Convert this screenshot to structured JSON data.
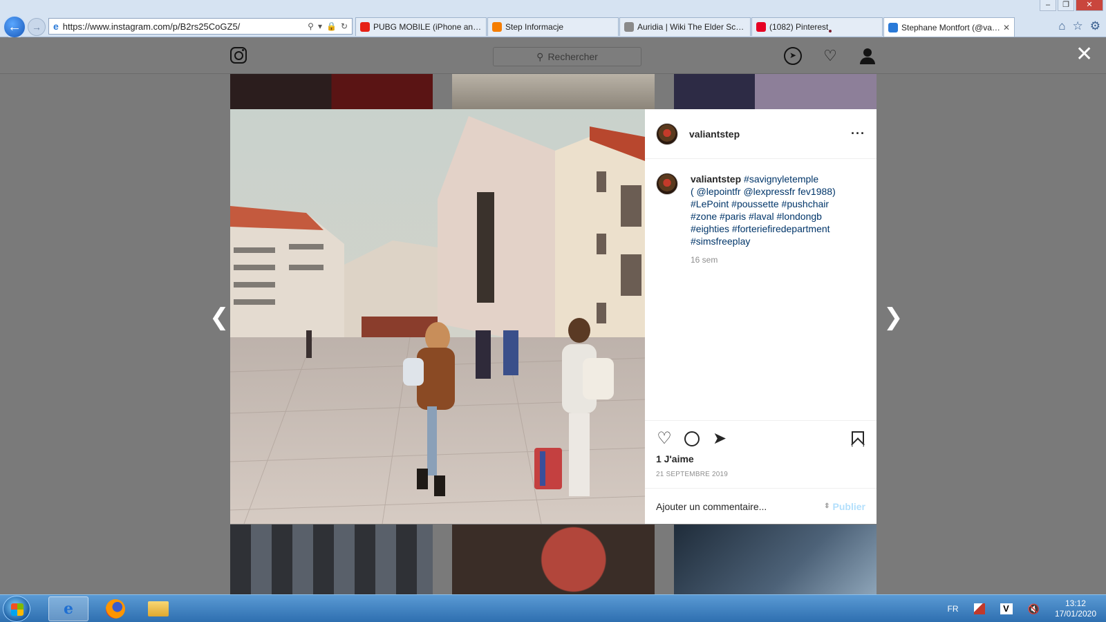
{
  "browser": {
    "url": "https://www.instagram.com/p/B2rs25CoGZ5/",
    "window_controls": [
      "–",
      "❐",
      "✕"
    ],
    "tabs": [
      {
        "label": "PUBG MOBILE (iPhone androi...",
        "icon": "youtube-icon",
        "color": "#e62117"
      },
      {
        "label": "Step Informacje",
        "icon": "blogger-icon",
        "color": "#f57d00"
      },
      {
        "label": "Auridia | Wiki The Elder Scroll...",
        "icon": "fandom-icon",
        "color": "#8a8a8a"
      },
      {
        "label": "(1082) Pinterest",
        "icon": "pinterest-icon",
        "color": "#e60023"
      },
      {
        "label": "Stephane Montfort (@vali...",
        "icon": "ie-icon",
        "color": "#2a7ad8",
        "active": true
      }
    ]
  },
  "instagram": {
    "search_placeholder": "Rechercher",
    "post": {
      "username": "valiantstep",
      "caption_lines": [
        "#savignyletemple",
        "( @lepointfr @lexpressfr fev1988)",
        "#LePoint #poussette #pushchair",
        "#zone #paris #laval #londongb",
        "#eighties #forteriefiredepartment",
        "#simsfreeplay"
      ],
      "caption_time": "16 sem",
      "likes": "1 J'aime",
      "date": "21 SEPTEMBRE 2019",
      "comment_placeholder": "Ajouter un commentaire...",
      "publish_label": "Publier"
    }
  },
  "taskbar": {
    "language": "FR",
    "time": "13:12",
    "date": "17/01/2020"
  }
}
